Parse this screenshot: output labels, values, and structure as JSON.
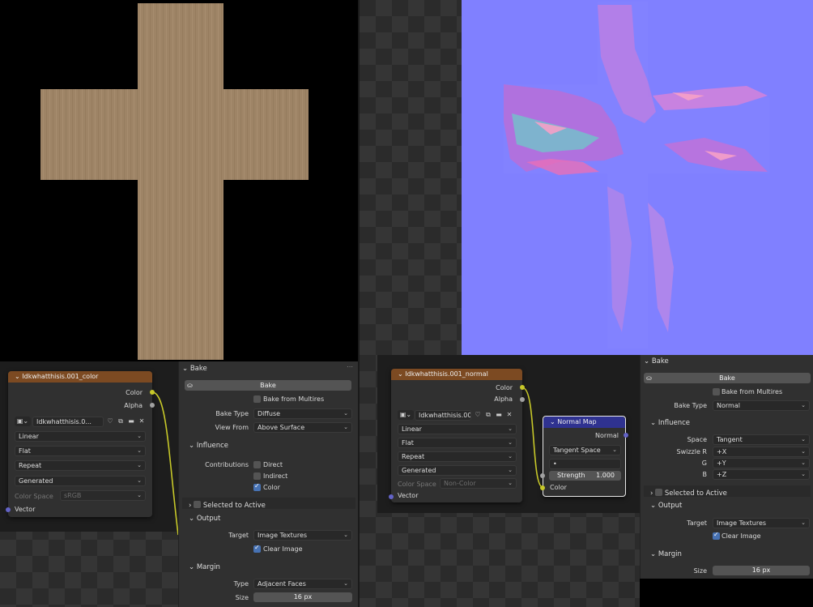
{
  "left": {
    "node": {
      "title": "Idkwhatthisis.001_color",
      "out_color": "Color",
      "out_alpha": "Alpha",
      "image_name": "Idkwhatthisis.0...",
      "interpolation": "Linear",
      "projection": "Flat",
      "extension": "Repeat",
      "source": "Generated",
      "color_space_label": "Color Space",
      "color_space": "sRGB",
      "in_vector": "Vector"
    },
    "bake": {
      "header": "Bake",
      "bake_button": "Bake",
      "bake_from_multires": "Bake from Multires",
      "bake_type_label": "Bake Type",
      "bake_type": "Diffuse",
      "view_from_label": "View From",
      "view_from": "Above Surface",
      "influence": "Influence",
      "contributions_label": "Contributions",
      "direct": "Direct",
      "indirect": "Indirect",
      "color": "Color",
      "selected_to_active": "Selected to Active",
      "output": "Output",
      "target_label": "Target",
      "target": "Image Textures",
      "clear_image": "Clear Image",
      "margin": "Margin",
      "type_label": "Type",
      "type": "Adjacent Faces",
      "size_label": "Size",
      "size": "16 px"
    }
  },
  "right": {
    "node": {
      "title": "Idkwhatthisis.001_normal",
      "out_color": "Color",
      "out_alpha": "Alpha",
      "image_name": "Idkwhatthisis.00...",
      "interpolation": "Linear",
      "projection": "Flat",
      "extension": "Repeat",
      "source": "Generated",
      "color_space_label": "Color Space",
      "color_space": "Non-Color",
      "in_vector": "Vector"
    },
    "normal_map": {
      "title": "Normal Map",
      "out_normal": "Normal",
      "space": "Tangent Space",
      "uv": "•",
      "strength_label": "Strength",
      "strength": "1.000",
      "in_color": "Color"
    },
    "bake": {
      "header": "Bake",
      "bake_button": "Bake",
      "bake_from_multires": "Bake from Multires",
      "bake_type_label": "Bake Type",
      "bake_type": "Normal",
      "influence": "Influence",
      "space_label": "Space",
      "space": "Tangent",
      "swizzle_r_label": "Swizzle R",
      "swizzle_r": "+X",
      "g_label": "G",
      "g": "+Y",
      "b_label": "B",
      "b": "+Z",
      "selected_to_active": "Selected to Active",
      "output": "Output",
      "target_label": "Target",
      "target": "Image Textures",
      "clear_image": "Clear Image",
      "margin": "Margin",
      "size_label": "Size",
      "size": "16 px"
    }
  },
  "colors": {
    "node_header_image": "#7c4a22",
    "node_header_vector": "#2f3290",
    "socket_color": "#c7c829",
    "socket_vector": "#6363c7",
    "normal_base": "#8080ff",
    "wood": "#9e8466",
    "checkbox_on": "#4772b3"
  }
}
